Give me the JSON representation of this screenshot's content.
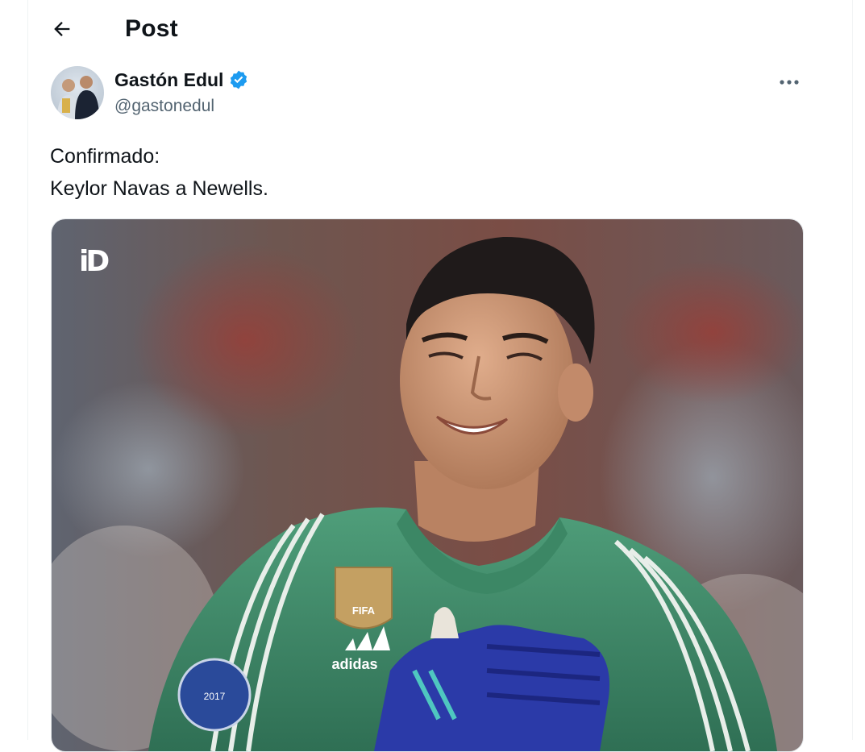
{
  "header": {
    "title": "Post",
    "back_icon": "arrow-left-icon"
  },
  "post": {
    "author": {
      "name": "Gastón Edul",
      "handle": "@gastonedul",
      "verified": true,
      "verified_color": "#1d9bf0"
    },
    "text_lines": [
      "Confirmado:",
      "Keylor Navas a Newells."
    ],
    "media": {
      "logo_text": "iD",
      "kit_brand": "adidas",
      "badge_text": "FIFA",
      "ucl_badge_year": "2017"
    }
  },
  "colors": {
    "text_primary": "#0f1419",
    "text_secondary": "#536471",
    "jersey_green": "#3f8d6a",
    "glove_blue": "#2b3aa8"
  }
}
